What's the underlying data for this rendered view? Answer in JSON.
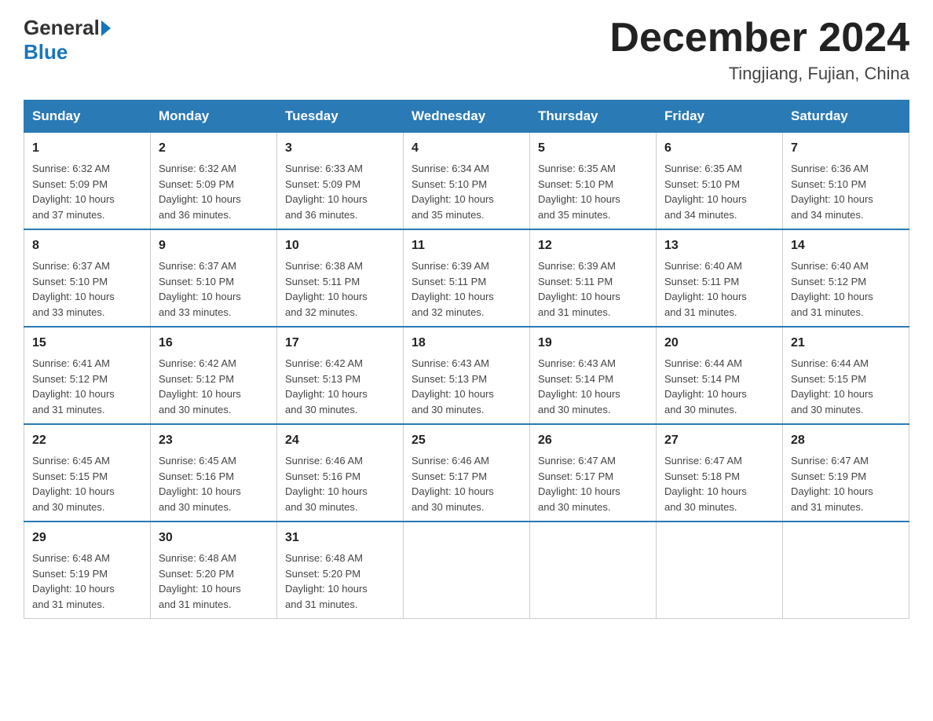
{
  "logo": {
    "general": "General",
    "blue": "Blue"
  },
  "title": {
    "month_year": "December 2024",
    "location": "Tingjiang, Fujian, China"
  },
  "days_of_week": [
    "Sunday",
    "Monday",
    "Tuesday",
    "Wednesday",
    "Thursday",
    "Friday",
    "Saturday"
  ],
  "weeks": [
    [
      {
        "day": "1",
        "sunrise": "6:32 AM",
        "sunset": "5:09 PM",
        "daylight": "10 hours and 37 minutes."
      },
      {
        "day": "2",
        "sunrise": "6:32 AM",
        "sunset": "5:09 PM",
        "daylight": "10 hours and 36 minutes."
      },
      {
        "day": "3",
        "sunrise": "6:33 AM",
        "sunset": "5:09 PM",
        "daylight": "10 hours and 36 minutes."
      },
      {
        "day": "4",
        "sunrise": "6:34 AM",
        "sunset": "5:10 PM",
        "daylight": "10 hours and 35 minutes."
      },
      {
        "day": "5",
        "sunrise": "6:35 AM",
        "sunset": "5:10 PM",
        "daylight": "10 hours and 35 minutes."
      },
      {
        "day": "6",
        "sunrise": "6:35 AM",
        "sunset": "5:10 PM",
        "daylight": "10 hours and 34 minutes."
      },
      {
        "day": "7",
        "sunrise": "6:36 AM",
        "sunset": "5:10 PM",
        "daylight": "10 hours and 34 minutes."
      }
    ],
    [
      {
        "day": "8",
        "sunrise": "6:37 AM",
        "sunset": "5:10 PM",
        "daylight": "10 hours and 33 minutes."
      },
      {
        "day": "9",
        "sunrise": "6:37 AM",
        "sunset": "5:10 PM",
        "daylight": "10 hours and 33 minutes."
      },
      {
        "day": "10",
        "sunrise": "6:38 AM",
        "sunset": "5:11 PM",
        "daylight": "10 hours and 32 minutes."
      },
      {
        "day": "11",
        "sunrise": "6:39 AM",
        "sunset": "5:11 PM",
        "daylight": "10 hours and 32 minutes."
      },
      {
        "day": "12",
        "sunrise": "6:39 AM",
        "sunset": "5:11 PM",
        "daylight": "10 hours and 31 minutes."
      },
      {
        "day": "13",
        "sunrise": "6:40 AM",
        "sunset": "5:11 PM",
        "daylight": "10 hours and 31 minutes."
      },
      {
        "day": "14",
        "sunrise": "6:40 AM",
        "sunset": "5:12 PM",
        "daylight": "10 hours and 31 minutes."
      }
    ],
    [
      {
        "day": "15",
        "sunrise": "6:41 AM",
        "sunset": "5:12 PM",
        "daylight": "10 hours and 31 minutes."
      },
      {
        "day": "16",
        "sunrise": "6:42 AM",
        "sunset": "5:12 PM",
        "daylight": "10 hours and 30 minutes."
      },
      {
        "day": "17",
        "sunrise": "6:42 AM",
        "sunset": "5:13 PM",
        "daylight": "10 hours and 30 minutes."
      },
      {
        "day": "18",
        "sunrise": "6:43 AM",
        "sunset": "5:13 PM",
        "daylight": "10 hours and 30 minutes."
      },
      {
        "day": "19",
        "sunrise": "6:43 AM",
        "sunset": "5:14 PM",
        "daylight": "10 hours and 30 minutes."
      },
      {
        "day": "20",
        "sunrise": "6:44 AM",
        "sunset": "5:14 PM",
        "daylight": "10 hours and 30 minutes."
      },
      {
        "day": "21",
        "sunrise": "6:44 AM",
        "sunset": "5:15 PM",
        "daylight": "10 hours and 30 minutes."
      }
    ],
    [
      {
        "day": "22",
        "sunrise": "6:45 AM",
        "sunset": "5:15 PM",
        "daylight": "10 hours and 30 minutes."
      },
      {
        "day": "23",
        "sunrise": "6:45 AM",
        "sunset": "5:16 PM",
        "daylight": "10 hours and 30 minutes."
      },
      {
        "day": "24",
        "sunrise": "6:46 AM",
        "sunset": "5:16 PM",
        "daylight": "10 hours and 30 minutes."
      },
      {
        "day": "25",
        "sunrise": "6:46 AM",
        "sunset": "5:17 PM",
        "daylight": "10 hours and 30 minutes."
      },
      {
        "day": "26",
        "sunrise": "6:47 AM",
        "sunset": "5:17 PM",
        "daylight": "10 hours and 30 minutes."
      },
      {
        "day": "27",
        "sunrise": "6:47 AM",
        "sunset": "5:18 PM",
        "daylight": "10 hours and 30 minutes."
      },
      {
        "day": "28",
        "sunrise": "6:47 AM",
        "sunset": "5:19 PM",
        "daylight": "10 hours and 31 minutes."
      }
    ],
    [
      {
        "day": "29",
        "sunrise": "6:48 AM",
        "sunset": "5:19 PM",
        "daylight": "10 hours and 31 minutes."
      },
      {
        "day": "30",
        "sunrise": "6:48 AM",
        "sunset": "5:20 PM",
        "daylight": "10 hours and 31 minutes."
      },
      {
        "day": "31",
        "sunrise": "6:48 AM",
        "sunset": "5:20 PM",
        "daylight": "10 hours and 31 minutes."
      },
      null,
      null,
      null,
      null
    ]
  ],
  "labels": {
    "sunrise": "Sunrise:",
    "sunset": "Sunset:",
    "daylight": "Daylight:"
  }
}
